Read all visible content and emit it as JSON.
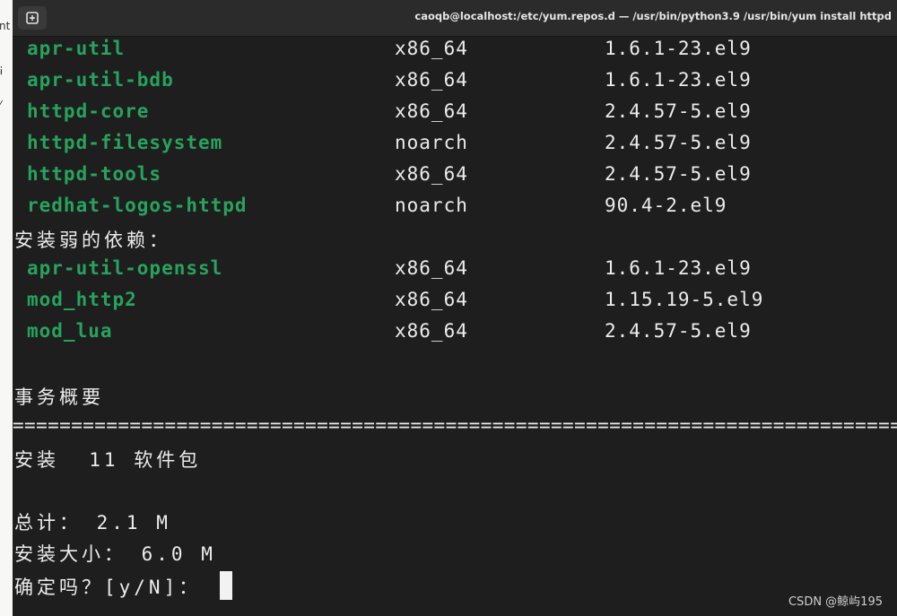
{
  "window": {
    "title": "caoqb@localhost:/etc/yum.repos.d — /usr/bin/python3.9 /usr/bin/yum install httpd"
  },
  "packages": [
    {
      "name": "apr-util",
      "arch": "x86_64",
      "version": "1.6.1-23.el9"
    },
    {
      "name": "apr-util-bdb",
      "arch": "x86_64",
      "version": "1.6.1-23.el9"
    },
    {
      "name": "httpd-core",
      "arch": "x86_64",
      "version": "2.4.57-5.el9"
    },
    {
      "name": "httpd-filesystem",
      "arch": "noarch",
      "version": "2.4.57-5.el9"
    },
    {
      "name": "httpd-tools",
      "arch": "x86_64",
      "version": "2.4.57-5.el9"
    },
    {
      "name": "redhat-logos-httpd",
      "arch": "noarch",
      "version": "90.4-2.el9"
    }
  ],
  "weak_deps_header": "安装弱的依赖：",
  "weak_packages": [
    {
      "name": "apr-util-openssl",
      "arch": "x86_64",
      "version": "1.6.1-23.el9"
    },
    {
      "name": "mod_http2",
      "arch": "x86_64",
      "version": "1.15.19-5.el9"
    },
    {
      "name": "mod_lua",
      "arch": "x86_64",
      "version": "2.4.57-5.el9"
    }
  ],
  "summary": {
    "header": "事务概要",
    "separator": "=====================================================================================",
    "install_line": "安装  11 软件包",
    "total_line": "总计： 2.1 M",
    "installed_size_line": "安装大小： 6.0 M",
    "prompt": "确定吗？[y/N]： "
  },
  "watermark": "CSDN @鲸屿195",
  "colors": {
    "package_name": "#27a35b",
    "text": "#ececec",
    "background": "#1e1e1e"
  }
}
